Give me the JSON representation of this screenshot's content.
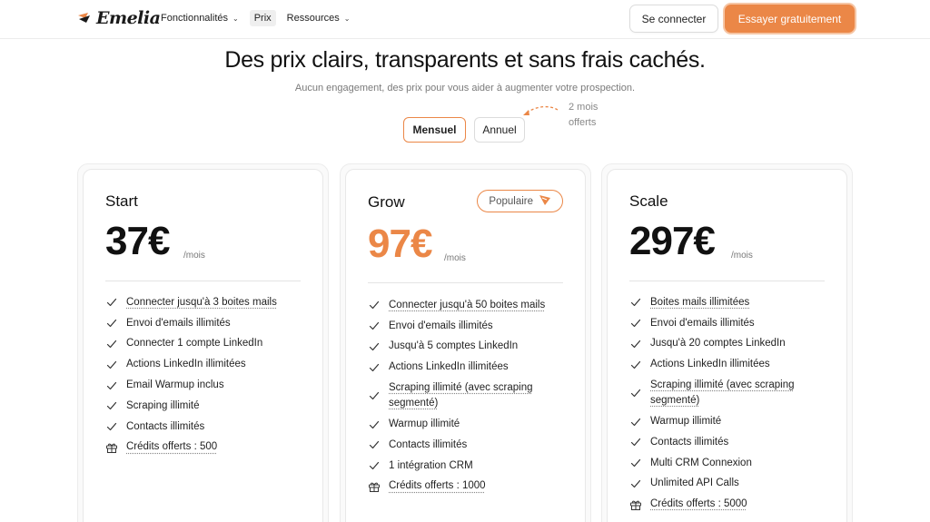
{
  "nav": {
    "logo_text": "Emelia",
    "links": [
      {
        "label": "Fonctionnalités",
        "has_dropdown": true
      },
      {
        "label": "Prix",
        "has_dropdown": false,
        "active": true
      },
      {
        "label": "Ressources",
        "has_dropdown": true
      }
    ],
    "login_label": "Se connecter",
    "try_label": "Essayer gratuitement"
  },
  "header": {
    "title": "Des prix clairs, transparents et sans frais cachés.",
    "subtitle": "Aucun engagement, des prix pour vous aider à augmenter votre prospection."
  },
  "billing": {
    "monthly_label": "Mensuel",
    "yearly_label": "Annuel",
    "offer_line1": "2 mois",
    "offer_line2": "offerts",
    "selected": "Mensuel"
  },
  "colors": {
    "accent": "#eb8747"
  },
  "plans": [
    {
      "name": "Start",
      "price": "37€",
      "period": "/mois",
      "features": [
        {
          "text": "Connecter jusqu'à 3 boites mails",
          "icon": "check-icon",
          "dotted": true
        },
        {
          "text": "Envoi d'emails illimités",
          "icon": "check-icon",
          "dotted": false
        },
        {
          "text": "Connecter 1 compte LinkedIn",
          "icon": "check-icon",
          "dotted": false
        },
        {
          "text": "Actions LinkedIn illimitées",
          "icon": "check-icon",
          "dotted": false
        },
        {
          "text": "Email Warmup inclus",
          "icon": "check-icon",
          "dotted": false
        },
        {
          "text": "Scraping illimité",
          "icon": "check-icon",
          "dotted": false
        },
        {
          "text": "Contacts illimités",
          "icon": "check-icon",
          "dotted": false
        },
        {
          "text": "Crédits offerts : 500",
          "icon": "gift-icon",
          "dotted": true
        }
      ]
    },
    {
      "name": "Grow",
      "price": "97€",
      "period": "/mois",
      "badge": "Populaire",
      "features": [
        {
          "text": "Connecter jusqu'à 50 boites mails",
          "icon": "check-icon",
          "dotted": true
        },
        {
          "text": "Envoi d'emails illimités",
          "icon": "check-icon",
          "dotted": false
        },
        {
          "text": "Jusqu'à 5 comptes LinkedIn",
          "icon": "check-icon",
          "dotted": false
        },
        {
          "text": "Actions LinkedIn illimitées",
          "icon": "check-icon",
          "dotted": false
        },
        {
          "text": "Scraping illimité (avec scraping segmenté)",
          "icon": "check-icon",
          "dotted": true
        },
        {
          "text": "Warmup illimité",
          "icon": "check-icon",
          "dotted": false
        },
        {
          "text": "Contacts illimités",
          "icon": "check-icon",
          "dotted": false
        },
        {
          "text": "1 intégration CRM",
          "icon": "check-icon",
          "dotted": false
        },
        {
          "text": "Crédits offerts : 1000",
          "icon": "gift-icon",
          "dotted": true
        }
      ]
    },
    {
      "name": "Scale",
      "price": "297€",
      "period": "/mois",
      "features": [
        {
          "text": "Boites mails illimitées",
          "icon": "check-icon",
          "dotted": true
        },
        {
          "text": "Envoi d'emails illimités",
          "icon": "check-icon",
          "dotted": false
        },
        {
          "text": "Jusqu'à 20 comptes LinkedIn",
          "icon": "check-icon",
          "dotted": false
        },
        {
          "text": "Actions LinkedIn illimitées",
          "icon": "check-icon",
          "dotted": false
        },
        {
          "text": "Scraping illimité (avec scraping segmenté)",
          "icon": "check-icon",
          "dotted": true
        },
        {
          "text": "Warmup illimité",
          "icon": "check-icon",
          "dotted": false
        },
        {
          "text": "Contacts illimités",
          "icon": "check-icon",
          "dotted": false
        },
        {
          "text": "Multi CRM Connexion",
          "icon": "check-icon",
          "dotted": false
        },
        {
          "text": "Unlimited API Calls",
          "icon": "check-icon",
          "dotted": false
        },
        {
          "text": "Crédits offerts : 5000",
          "icon": "gift-icon",
          "dotted": true
        }
      ]
    }
  ]
}
